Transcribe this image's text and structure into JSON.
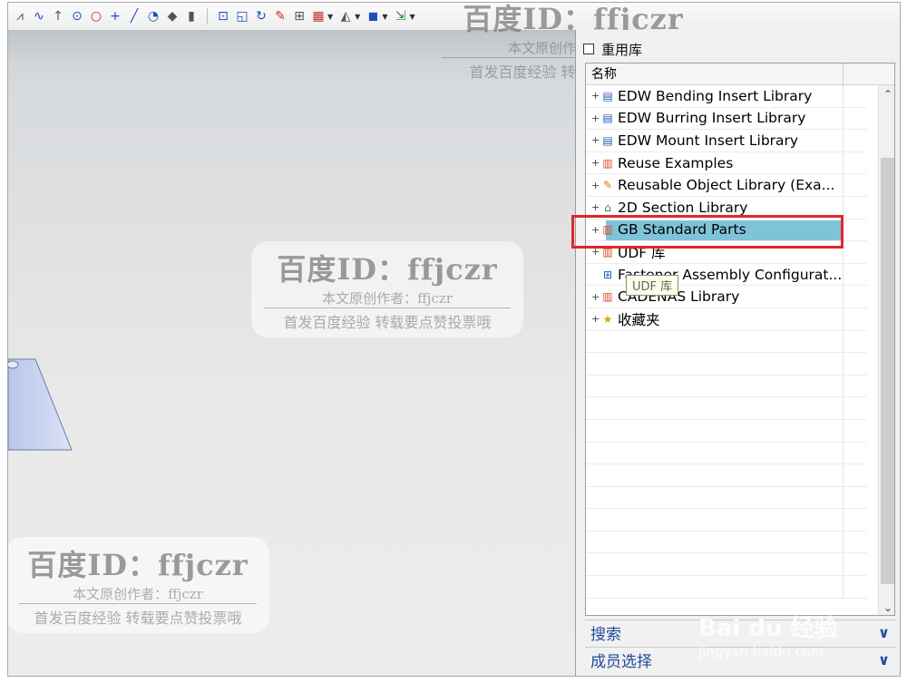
{
  "toolbar": {
    "icons": [
      "spline-icon",
      "curve-icon",
      "point-icon",
      "circle-center-icon",
      "circle-icon",
      "plus-icon",
      "line-icon",
      "arc-icon",
      "fill-icon",
      "book-icon",
      "view-icon",
      "rect-icon",
      "rotate-icon",
      "paint-icon",
      "tree-icon",
      "grid-icon",
      "shape-icon",
      "cube-icon",
      "move-icon"
    ]
  },
  "panel": {
    "title": "重用库",
    "column_header": "名称",
    "items": [
      {
        "label": "EDW Bending Insert Library",
        "icon": "library-icon",
        "expander": "+"
      },
      {
        "label": "EDW Burring Insert Library",
        "icon": "library-icon",
        "expander": "+"
      },
      {
        "label": "EDW Mount Insert Library",
        "icon": "library-icon",
        "expander": "+"
      },
      {
        "label": "Reuse Examples",
        "icon": "books-icon",
        "expander": "+"
      },
      {
        "label": "Reusable Object Library (Exa...",
        "icon": "edit-icon",
        "expander": "+"
      },
      {
        "label": "2D Section Library",
        "icon": "section-icon",
        "expander": "+"
      },
      {
        "label": "GB Standard Parts",
        "icon": "books-icon",
        "expander": "+",
        "selected": true
      },
      {
        "label": "UDF 库",
        "icon": "books-icon",
        "expander": "+"
      },
      {
        "label": "Fastener Assembly Configurat...",
        "icon": "fastener-icon",
        "expander": ""
      },
      {
        "label": "CADENAS Library",
        "icon": "books-icon",
        "expander": "+"
      },
      {
        "label": "收藏夹",
        "icon": "star-icon",
        "expander": "+"
      }
    ],
    "tooltip": "UDF 库",
    "sections": [
      {
        "label": "搜索"
      },
      {
        "label": "成员选择"
      }
    ]
  },
  "watermarks": {
    "title": "百度ID：ffjczr",
    "author": "本文原创作者：ffjczr",
    "note": "首发百度经验  转载要点赞投票哦",
    "top_title": "百度ID：ffjczr",
    "top_author": "本文原创作者：ffjczr",
    "top_note": "首发百度经验  转载要点赞投票哦",
    "corner_title": "百度ID：ffjczr",
    "corner_author": "本文原创作者：ffjczr",
    "corner_note": "首发百度经验  转载要点赞投票哦"
  },
  "logo": {
    "brand": "Bai du 经验",
    "url": "jingyan.baidu.com"
  },
  "colors": {
    "selection": "#7fc3d9",
    "highlight_border": "#e0262a",
    "section_text": "#1f4b9a"
  }
}
